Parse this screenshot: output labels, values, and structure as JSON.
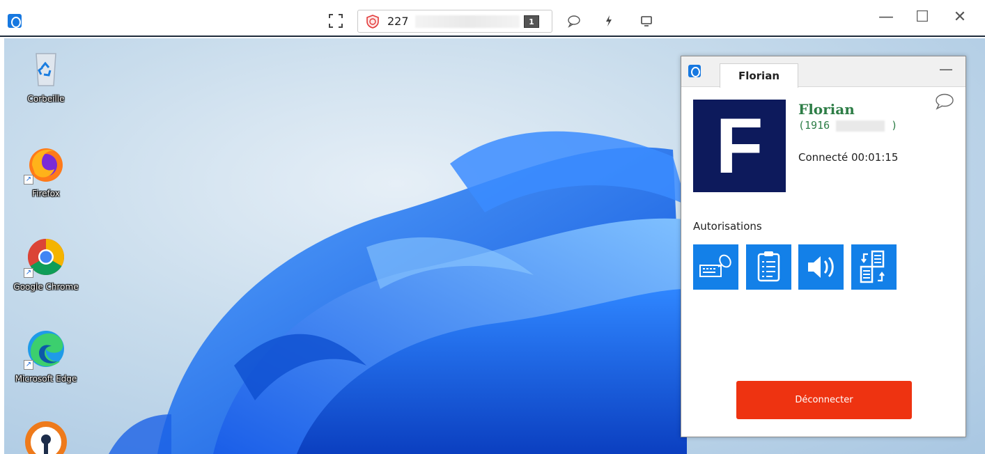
{
  "topbar": {
    "session_id": "227",
    "monitor_number": "1",
    "icons": [
      "fullscreen-icon",
      "shield-icon",
      "chat-icon",
      "bolt-icon",
      "screen-icon"
    ],
    "window_controls": {
      "minimize": "—",
      "maximize": "☐",
      "close": "✕"
    }
  },
  "desktop": {
    "icons": [
      {
        "label": "Corbeille",
        "icon": "recycle-bin-icon"
      },
      {
        "label": "Firefox",
        "icon": "firefox-icon"
      },
      {
        "label": "Google Chrome",
        "icon": "chrome-icon"
      },
      {
        "label": "Microsoft Edge",
        "icon": "edge-icon"
      },
      {
        "label": "",
        "icon": "openvpn-icon"
      }
    ]
  },
  "panel": {
    "tab_label": "Florian",
    "minimize": "—",
    "avatar_letter": "F",
    "user_name": "Florian",
    "user_id_prefix": "(1916",
    "user_id_suffix": ")",
    "connection_status": "Connecté 00:01:15",
    "permissions_label": "Autorisations",
    "permissions": [
      "keyboard-mouse-icon",
      "clipboard-icon",
      "sound-icon",
      "file-transfer-icon"
    ],
    "disconnect_label": "Déconnecter",
    "colors": {
      "accent": "#1380e8",
      "avatar_bg": "#0d1a5c",
      "name": "#2d7d46",
      "disconnect": "#ee3311"
    }
  }
}
